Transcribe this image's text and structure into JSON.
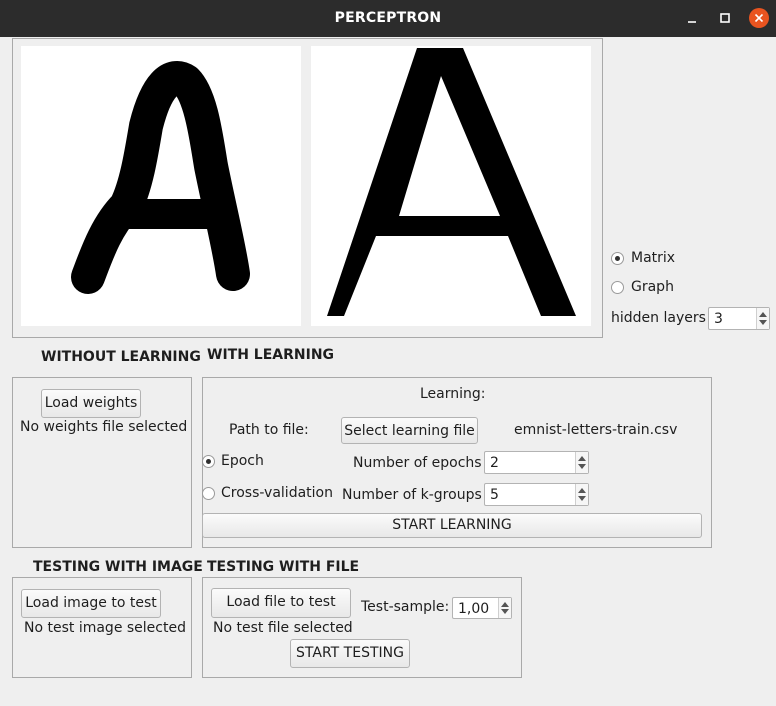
{
  "window": {
    "title": "PERCEPTRON"
  },
  "view_options": {
    "matrix_label": "Matrix",
    "graph_label": "Graph",
    "selected": "Matrix",
    "hidden_layers_label": "hidden layers",
    "hidden_layers_value": "3"
  },
  "without_learning": {
    "heading": "WITHOUT LEARNING",
    "load_weights": "Load weights",
    "status": "No weights file selected"
  },
  "with_learning": {
    "heading": "WITH LEARNING",
    "learning_label": "Learning:",
    "path_label": "Path to file:",
    "select_button": "Select learning file",
    "file_name": "emnist-letters-train.csv",
    "epoch_label": "Epoch",
    "cross_validation_label": "Cross-validation",
    "selected_mode": "Epoch",
    "epochs_label": "Number of epochs",
    "epochs_value": "2",
    "kgroups_label": "Number of k-groups",
    "kgroups_value": "5",
    "start_button": "START LEARNING"
  },
  "testing_image": {
    "heading": "TESTING WITH IMAGE",
    "load_button": "Load image to test",
    "status": "No test image selected"
  },
  "testing_file": {
    "heading": "TESTING WITH FILE",
    "load_button": "Load file to test",
    "sample_label": "Test-sample:",
    "sample_value": "1,00",
    "status": "No test file selected",
    "start_button": "START TESTING"
  }
}
